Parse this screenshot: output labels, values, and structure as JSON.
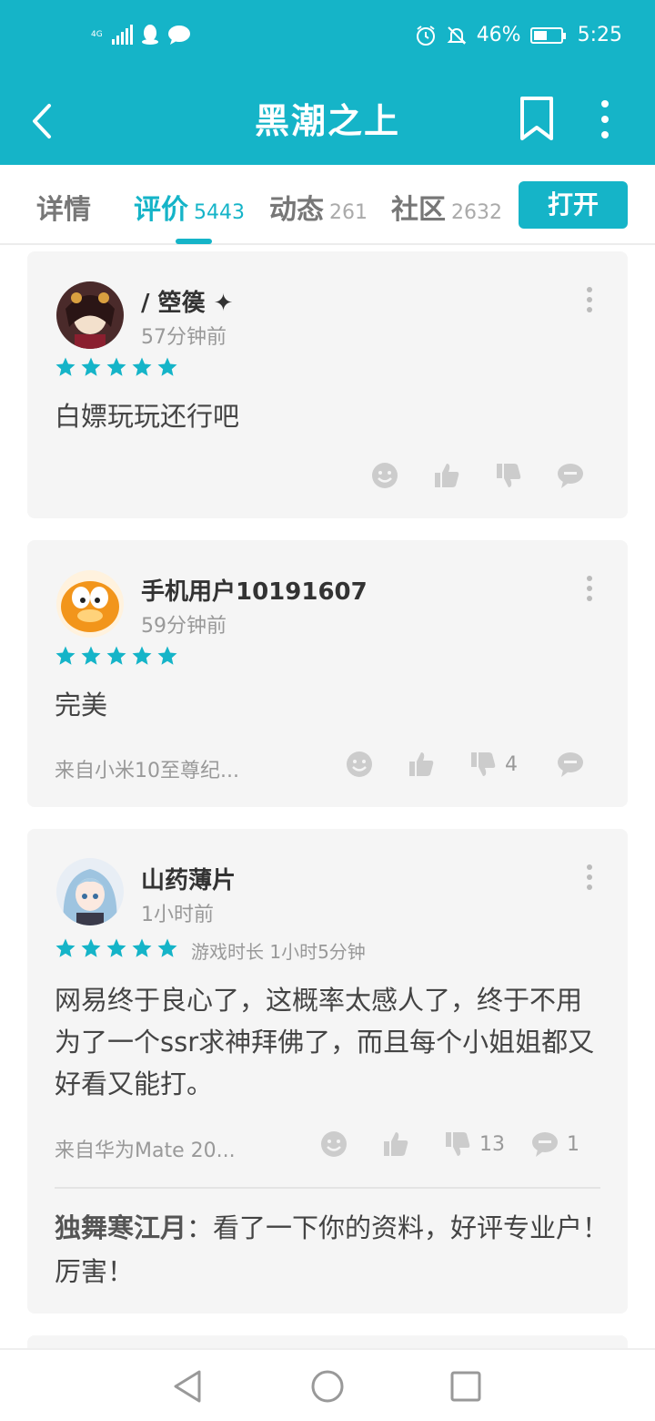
{
  "status_bar": {
    "network": "4G",
    "battery": "46%",
    "time": "5:25",
    "icons": [
      "signal-icon",
      "qq-icon",
      "chat-icon",
      "alarm-icon",
      "mute-icon",
      "battery-icon"
    ]
  },
  "header": {
    "title": "黑潮之上",
    "icons": [
      "back-icon",
      "bookmark-icon",
      "more-icon"
    ]
  },
  "tabs": [
    {
      "label": "详情",
      "count": ""
    },
    {
      "label": "评价",
      "count": "5443"
    },
    {
      "label": "动态",
      "count": "261"
    },
    {
      "label": "社区",
      "count": "2632"
    }
  ],
  "open_button": "打开",
  "colors": {
    "accent": "#15b4c8",
    "star": "#15b4c8",
    "card_bg": "#f5f5f5"
  },
  "reviews": [
    {
      "user": "/ 箜篌 ✦",
      "time": "57分钟前",
      "rating": 5,
      "content": "白嫖玩玩还行吧",
      "device": "",
      "likes": "",
      "dislikes": "",
      "comments": ""
    },
    {
      "user": "手机用户10191607",
      "time": "59分钟前",
      "rating": 5,
      "content": "完美",
      "device": "来自小米10至尊纪...",
      "likes": "",
      "dislikes": "4",
      "comments": ""
    },
    {
      "user": "山药薄片",
      "time": "1小时前",
      "rating": 5,
      "playtime": "游戏时长 1小时5分钟",
      "content": "网易终于良心了，这概率太感人了，终于不用为了一个ssr求神拜佛了，而且每个小姐姐都又好看又能打。",
      "device": "来自华为Mate 20...",
      "likes": "",
      "dislikes": "13",
      "comments": "1",
      "reply": {
        "user": "独舞寒江月",
        "sep": "：",
        "text": "看了一下你的资料，好评专业户！厉害！"
      }
    }
  ]
}
